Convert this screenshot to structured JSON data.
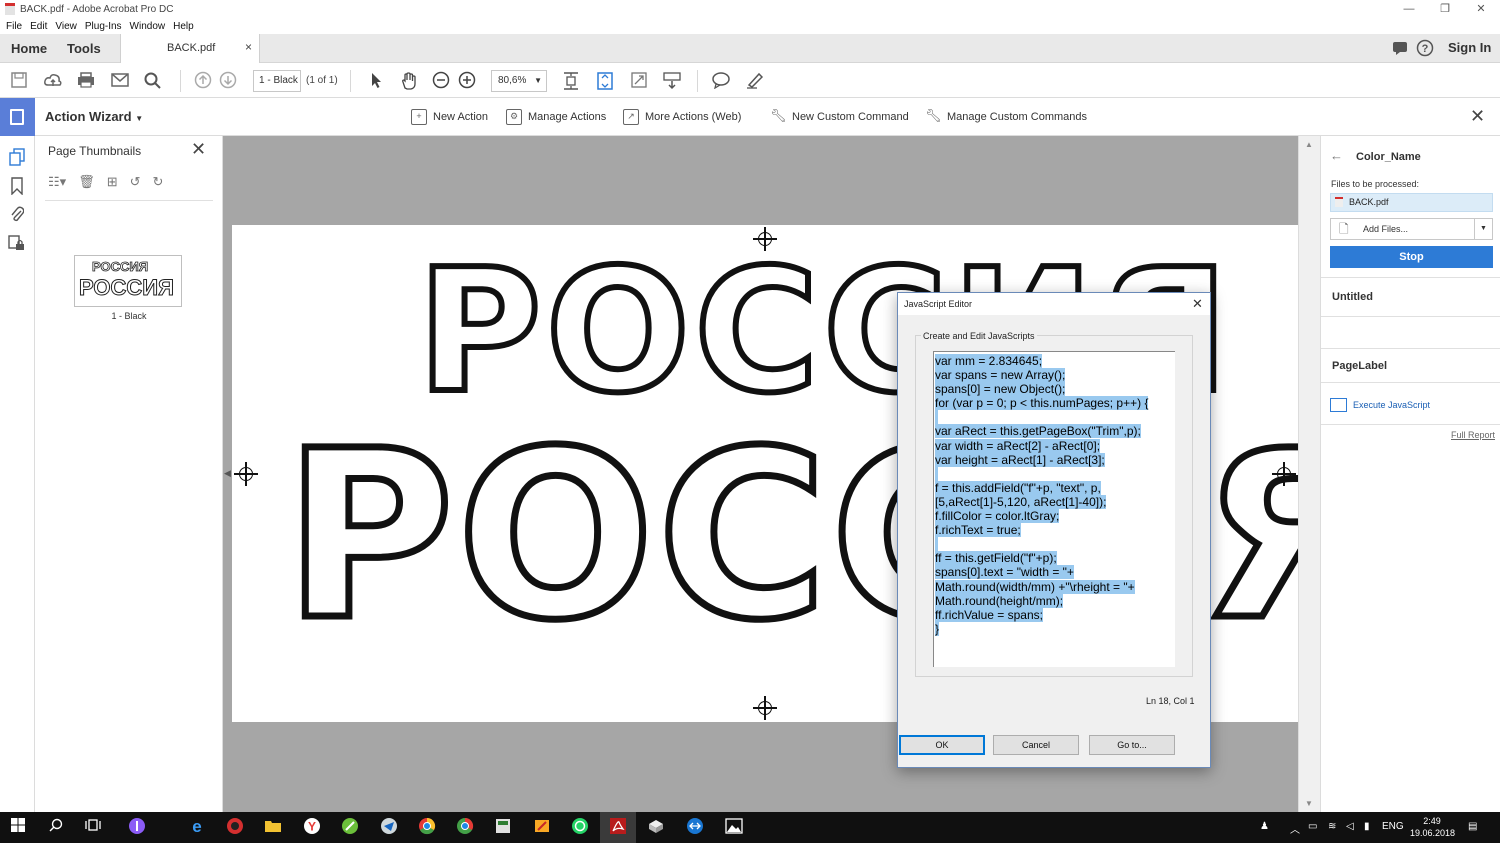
{
  "window": {
    "title": "BACK.pdf - Adobe Acrobat Pro DC",
    "minimize": "—",
    "maximize": "❐",
    "close": "✕"
  },
  "menu": [
    "File",
    "Edit",
    "View",
    "Plug-Ins",
    "Window",
    "Help"
  ],
  "tabs": {
    "home": "Home",
    "tools": "Tools",
    "document": "BACK.pdf",
    "close": "×",
    "sign_in": "Sign In"
  },
  "toolbar": {
    "page_label": "1 - Black",
    "page_count": "(1 of 1)",
    "zoom": "80,6%"
  },
  "action_wizard": {
    "title": "Action Wizard",
    "commands": [
      "New Action",
      "Manage Actions",
      "More Actions (Web)",
      "New Custom Command",
      "Manage Custom Commands"
    ]
  },
  "thumbnails": {
    "header": "Page Thumbnails",
    "thumb_line1": "РОССИЯ",
    "thumb_line2": "РОССИЯ",
    "thumb_label": "1 - Black"
  },
  "document": {
    "line1": "РОССИЯ",
    "line2": "РОССИЯ"
  },
  "right_panel": {
    "title": "Color_Name",
    "files_label": "Files to be processed:",
    "file": "BACK.pdf",
    "add_files": "Add Files...",
    "stop": "Stop",
    "section1": "Untitled",
    "section2": "PageLabel",
    "execute": "Execute JavaScript",
    "full_report": "Full Report"
  },
  "js_editor": {
    "title": "JavaScript Editor",
    "group_label": "Create and Edit JavaScripts",
    "code_lines": [
      "var mm = 2.834645;",
      "var spans = new Array();",
      "spans[0] = new Object();",
      "for (var p = 0; p < this.numPages; p++) {",
      "",
      "var aRect = this.getPageBox(\"Trim\",p);",
      "var width = aRect[2] - aRect[0];",
      "var height = aRect[1] - aRect[3];",
      "",
      "f = this.addField(\"f\"+p, \"text\", p,",
      "[5,aRect[1]-5,120, aRect[1]-40]);",
      "f.fillColor = color.ltGray;",
      "f.richText = true;",
      "",
      "ff = this.getField(\"f\"+p);",
      "spans[0].text = \"width = \"+",
      "Math.round(width/mm) +\"\\rheight = \"+",
      "Math.round(height/mm);",
      "ff.richValue = spans;",
      "}"
    ],
    "cursor_pos": "Ln 18, Col 1",
    "ok": "OK",
    "cancel": "Cancel",
    "goto": "Go to..."
  },
  "taskbar": {
    "language": "ENG",
    "time": "2:49",
    "date": "19.06.2018"
  },
  "colors": {
    "accent_blue": "#2d7bd6",
    "selection": "#99c9ef",
    "pdf_red": "#d3302f"
  }
}
